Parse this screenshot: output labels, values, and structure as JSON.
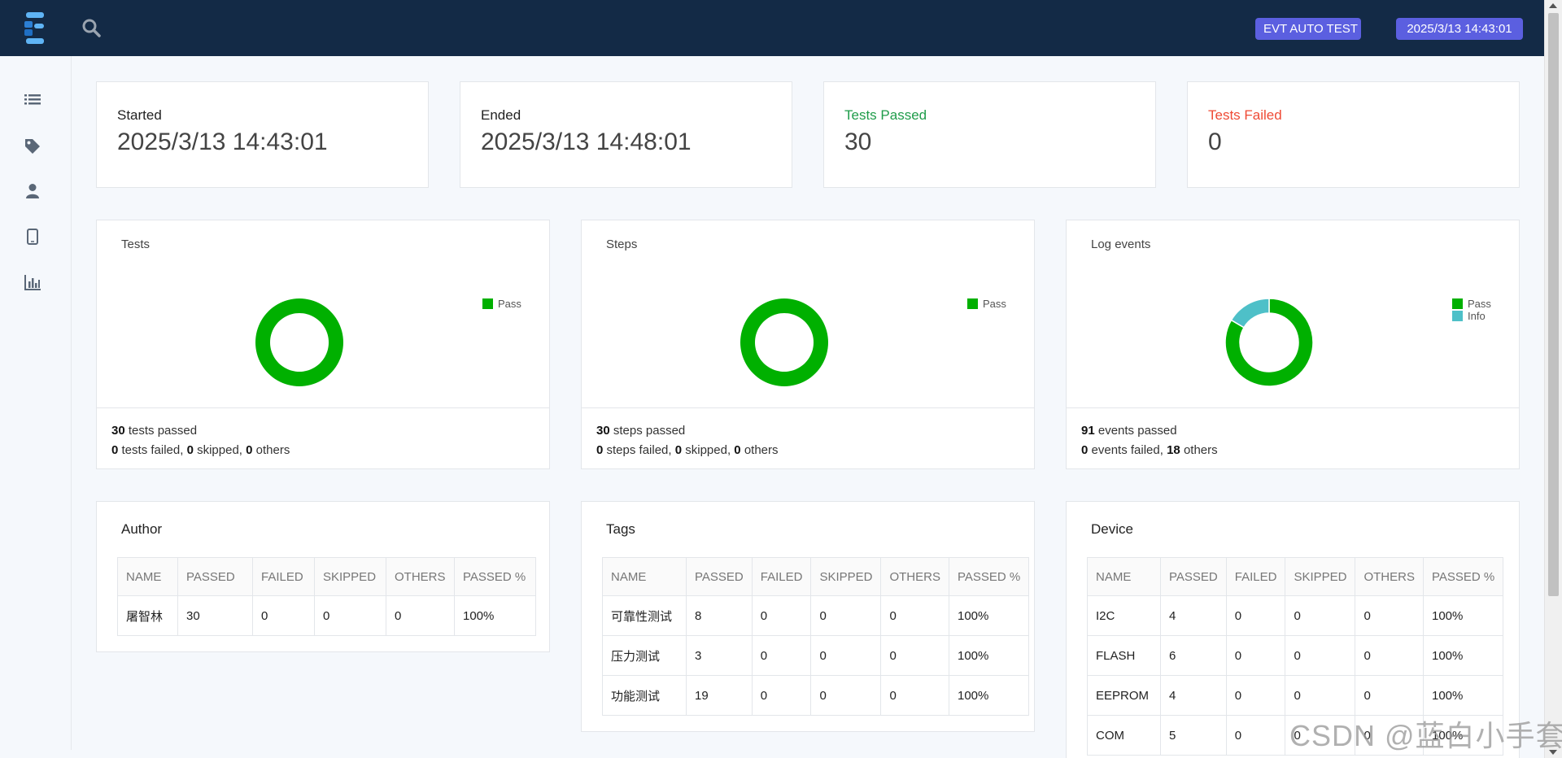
{
  "topbar": {
    "project_badge": "EVT AUTO TEST",
    "date_badge": "2025/3/13 14:43:01"
  },
  "sidebar": {
    "icons": [
      "list-icon",
      "tag-icon",
      "user-icon",
      "tablet-icon",
      "bar-chart-icon"
    ]
  },
  "summary": {
    "started": {
      "label": "Started",
      "value": "2025/3/13 14:43:01"
    },
    "ended": {
      "label": "Ended",
      "value": "2025/3/13 14:48:01"
    },
    "tests_passed": {
      "label": "Tests Passed",
      "value": "30"
    },
    "tests_failed": {
      "label": "Tests Failed",
      "value": "0"
    }
  },
  "colors": {
    "pass": "#00b000",
    "info": "#4ec0c8",
    "passed_text": "#1f9c4a",
    "failed_text": "#ef4a35",
    "badge": "#5b5fe0",
    "topbar": "#132a46"
  },
  "charts": {
    "tests": {
      "title": "Tests",
      "legend": [
        "Pass"
      ],
      "foot": {
        "passed_count": "30",
        "passed_text": "tests passed",
        "failed_count": "0",
        "failed_text": "tests failed,",
        "skipped_count": "0",
        "skipped_text": "skipped,",
        "others_count": "0",
        "others_text": "others"
      }
    },
    "steps": {
      "title": "Steps",
      "legend": [
        "Pass"
      ],
      "foot": {
        "passed_count": "30",
        "passed_text": "steps passed",
        "failed_count": "0",
        "failed_text": "steps failed,",
        "skipped_count": "0",
        "skipped_text": "skipped,",
        "others_count": "0",
        "others_text": "others"
      }
    },
    "log_events": {
      "title": "Log events",
      "legend": [
        "Pass",
        "Info"
      ],
      "foot": {
        "passed_count": "91",
        "passed_text": "events passed",
        "failed_count": "0",
        "failed_text": "events failed,",
        "others_count": "18",
        "others_text": "others"
      }
    }
  },
  "chart_data": [
    {
      "type": "pie",
      "categories": [
        "Pass"
      ],
      "values": [
        30
      ],
      "title": "Tests",
      "legend": "top-right"
    },
    {
      "type": "pie",
      "categories": [
        "Pass"
      ],
      "values": [
        30
      ],
      "title": "Steps",
      "legend": "top-right"
    },
    {
      "type": "pie",
      "categories": [
        "Pass",
        "Info"
      ],
      "values": [
        91,
        18
      ],
      "title": "Log events",
      "legend": "top-right"
    }
  ],
  "tables": {
    "author": {
      "title": "Author",
      "headers": [
        "NAME",
        "PASSED",
        "FAILED",
        "SKIPPED",
        "OTHERS",
        "PASSED %"
      ],
      "rows": [
        [
          "屠智林",
          "30",
          "0",
          "0",
          "0",
          "100%"
        ]
      ]
    },
    "tags": {
      "title": "Tags",
      "headers": [
        "NAME",
        "PASSED",
        "FAILED",
        "SKIPPED",
        "OTHERS",
        "PASSED %"
      ],
      "rows": [
        [
          "可靠性测试",
          "8",
          "0",
          "0",
          "0",
          "100%"
        ],
        [
          "压力测试",
          "3",
          "0",
          "0",
          "0",
          "100%"
        ],
        [
          "功能测试",
          "19",
          "0",
          "0",
          "0",
          "100%"
        ]
      ]
    },
    "device": {
      "title": "Device",
      "headers": [
        "NAME",
        "PASSED",
        "FAILED",
        "SKIPPED",
        "OTHERS",
        "PASSED %"
      ],
      "rows": [
        [
          "I2C",
          "4",
          "0",
          "0",
          "0",
          "100%"
        ],
        [
          "FLASH",
          "6",
          "0",
          "0",
          "0",
          "100%"
        ],
        [
          "EEPROM",
          "4",
          "0",
          "0",
          "0",
          "100%"
        ],
        [
          "COM",
          "5",
          "0",
          "0",
          "0",
          "100%"
        ]
      ]
    }
  },
  "watermark": "CSDN @蓝白小手套"
}
